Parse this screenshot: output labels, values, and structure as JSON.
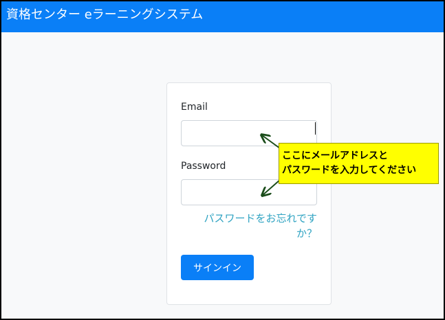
{
  "header": {
    "title": "資格センター eラーニングシステム"
  },
  "login": {
    "email_label": "Email",
    "email_value": "",
    "password_label": "Password",
    "password_value": "",
    "forgot_link": "パスワードをお忘れですか？",
    "signin_button": "サインイン"
  },
  "annotation": {
    "line1": "ここにメールアドレスと",
    "line2": "パスワードを入力してください"
  },
  "colors": {
    "brand": "#0a7ff7",
    "link": "#2fa3c2",
    "callout": "#ffff00",
    "arrow": "#1b4d1b"
  }
}
